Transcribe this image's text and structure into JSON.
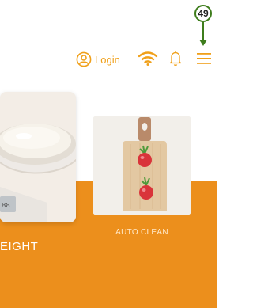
{
  "annotation": {
    "number": "49"
  },
  "header": {
    "login_label": "Login",
    "icons": [
      "user-circle-icon",
      "wifi-icon",
      "bell-icon",
      "hamburger-menu-icon"
    ]
  },
  "cards": [
    {
      "label": "EIGHT",
      "image": "flour-bowl-on-scale"
    },
    {
      "label": "AUTO CLEAN",
      "image": "cutting-board-with-radishes"
    }
  ],
  "colors": {
    "accent": "#f0a01a",
    "band": "#ec8f1c",
    "marker": "#3e7d1c"
  }
}
